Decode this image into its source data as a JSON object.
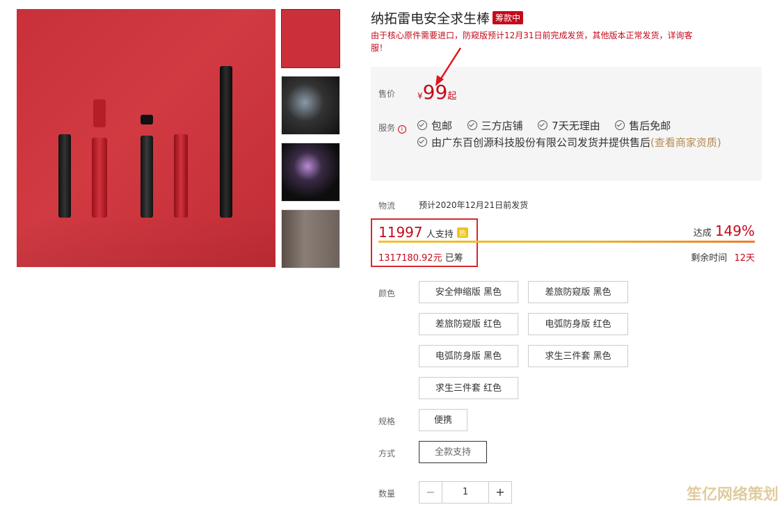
{
  "product": {
    "title": "纳拓雷电安全求生棒",
    "badge": "筹款中",
    "notice": "由于核心原件需要进口，防窥版预计12月31日前完成发货，其他版本正常发货，详询客服！"
  },
  "price": {
    "label": "售价",
    "currency": "¥",
    "value": "99",
    "suffix": "起"
  },
  "service": {
    "label": "服务",
    "info_icon": "info-circle-icon",
    "items": [
      "包邮",
      "三方店铺",
      "7天无理由",
      "售后免邮"
    ],
    "seller_text": "由广东百创源科技股份有限公司发货并提供售后",
    "seller_link": "(查看商家资质)"
  },
  "logistics": {
    "label": "物流",
    "value": "预计2020年12月21日前发货"
  },
  "funding": {
    "supporters": "11997",
    "supporters_label": "人支持",
    "hot_badge": "热",
    "raised": "1317180.92元",
    "raised_label": "已筹",
    "reached_label": "达成",
    "reached_pct": "149%",
    "progress_fraction": 1.0,
    "remaining_label": "剩余时间",
    "remaining_value": "12天"
  },
  "color": {
    "label": "颜色",
    "options": [
      "安全伸缩版 黑色",
      "差旅防窥版 黑色",
      "差旅防窥版 红色",
      "电弧防身版 红色",
      "电弧防身版 黑色",
      "求生三件套 黑色",
      "求生三件套 红色"
    ]
  },
  "spec": {
    "label": "规格",
    "options": [
      "便携"
    ]
  },
  "method": {
    "label": "方式",
    "options": [
      "全款支持"
    ],
    "selected": "全款支持"
  },
  "quantity": {
    "label": "数量",
    "value": "1",
    "minus": "−",
    "plus": "+"
  },
  "watermark": "笙亿网络策划",
  "colors": {
    "accent_red": "#c40a1b",
    "link_tan": "#b68a51",
    "panel_bg": "#f5f5f5",
    "hero_red": "#c9303a"
  }
}
